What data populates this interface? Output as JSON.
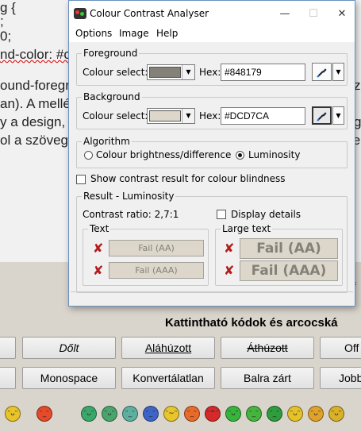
{
  "window": {
    "title": "Colour Contrast Analyser",
    "minimize_glyph": "—",
    "maximize_glyph": "☐",
    "close_glyph": "✕"
  },
  "menu": [
    "Options",
    "Image",
    "Help"
  ],
  "foreground": {
    "group_title": "Foreground",
    "colour_select_label": "Colour select:",
    "hex_label": "Hex:",
    "hex_value": "#848179",
    "swatch_color": "#848179"
  },
  "background": {
    "group_title": "Background",
    "colour_select_label": "Colour select:",
    "hex_label": "Hex:",
    "hex_value": "#DCD7CA",
    "swatch_color": "#DCD7CA"
  },
  "algorithm": {
    "group_title": "Algorithm",
    "option_brightness": "Colour brightness/difference",
    "option_luminosity": "Luminosity",
    "selected": "Luminosity"
  },
  "colour_blindness_checkbox": "Show contrast result for colour blindness",
  "result": {
    "group_title": "Result - Luminosity",
    "contrast_ratio": "Contrast ratio: 2,7:1",
    "display_details": "Display details",
    "text_group": "Text",
    "large_text_group": "Large text",
    "text_aa": "Fail (AA)",
    "text_aaa": "Fail (AAA)",
    "large_aa": "Fail (AA)",
    "large_aaa": "Fail (AAA)",
    "fail_glyph": "✘",
    "fail_color": "#b31c1c"
  },
  "background_page": {
    "editor_lines": [
      "g {",
      ";",
      "0;",
      "nd-color: #c",
      "ound-foregr",
      "an). A mellé",
      "y a design,",
      "ol a szöveg"
    ],
    "right_fragments": [
      "z",
      "g",
      "fe",
      "f"
    ],
    "heading": "Kattintható kódok és arcocská",
    "buttons_row1": [
      "Dőlt",
      "Aláhúzott",
      "Áthúzott",
      "Off"
    ],
    "buttons_row2": [
      "Monospace",
      "Konvertálatlan",
      "Balra zárt",
      "Jobb"
    ],
    "smileys": [
      {
        "face": "ᵔᴗᵔ",
        "color": "#e8c32a"
      },
      {
        "face": "ᵔ_ᵔ",
        "color": "#e54a2a"
      },
      {
        "face": "ᵔᴗᵔ",
        "color": "#3aa86b"
      },
      {
        "face": "ᵔᴗᵔ",
        "color": "#4aa56c"
      },
      {
        "face": "ᵔ_ᵔ",
        "color": "#5db0a0"
      },
      {
        "face": "ᵔ_ᵔ",
        "color": "#3e64c7"
      },
      {
        "face": "ᵔ~ᵔ",
        "color": "#e6c52d"
      },
      {
        "face": "ᵔ_ᵔ",
        "color": "#e86a2a"
      },
      {
        "face": "ᵔ^ᵔ",
        "color": "#d42a2a"
      },
      {
        "face": "ᵔᴗᵔ",
        "color": "#37b43b"
      },
      {
        "face": "ᵔ_ᵔ",
        "color": "#45b53e"
      },
      {
        "face": "ᵔ_ᵔ",
        "color": "#2e9d3e"
      },
      {
        "face": "ᵔᴗᵔ",
        "color": "#e6c12a"
      },
      {
        "face": "ᵔᴗᵔ",
        "color": "#e0a22a"
      },
      {
        "face": "ᵔᴗᵔ",
        "color": "#d8b02a"
      }
    ]
  }
}
